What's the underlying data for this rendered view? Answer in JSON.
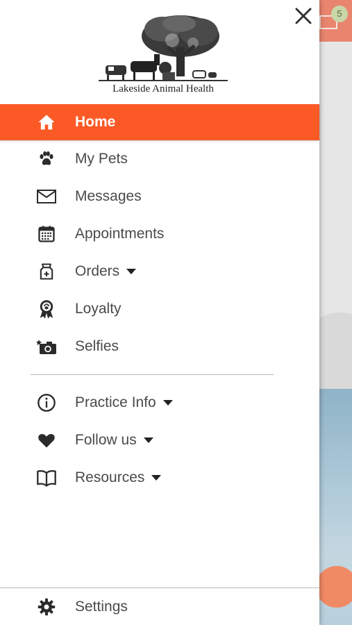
{
  "background_app": {
    "badge_count": "5"
  },
  "drawer": {
    "logo_text": "Lakeside Animal Health",
    "menu": [
      {
        "label": "Home",
        "icon": "home-icon",
        "active": true
      },
      {
        "label": "My Pets",
        "icon": "paw-icon"
      },
      {
        "label": "Messages",
        "icon": "envelope-icon"
      },
      {
        "label": "Appointments",
        "icon": "calendar-icon"
      },
      {
        "label": "Orders",
        "icon": "food-bag-icon",
        "dropdown": true
      },
      {
        "label": "Loyalty",
        "icon": "award-ribbon-icon"
      },
      {
        "label": "Selfies",
        "icon": "camera-icon"
      }
    ],
    "secondary_menu": [
      {
        "label": "Practice Info",
        "icon": "info-icon",
        "dropdown": true
      },
      {
        "label": "Follow us",
        "icon": "heart-icon",
        "dropdown": true
      },
      {
        "label": "Resources",
        "icon": "book-icon",
        "dropdown": true
      }
    ],
    "settings_label": "Settings"
  },
  "colors": {
    "accent": "#fb5a26",
    "text": "#4a4a4a",
    "icon": "#2b2b2b"
  }
}
